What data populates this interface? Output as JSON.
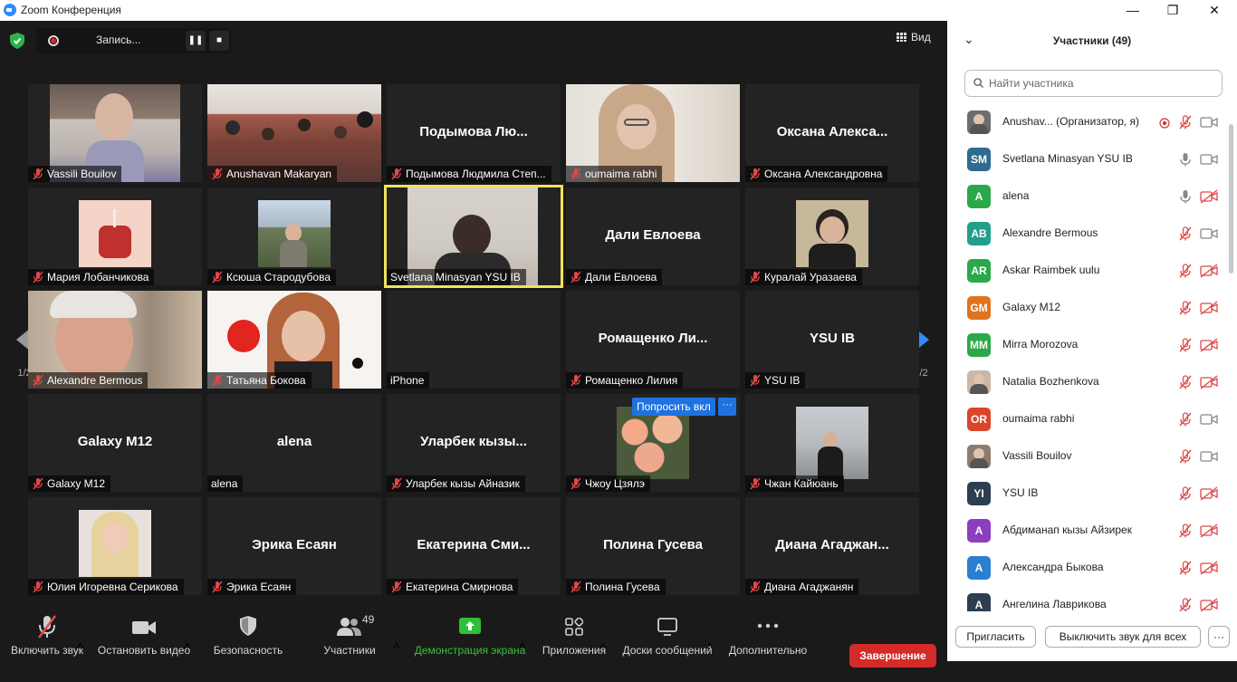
{
  "window": {
    "title": "Zoom Конференция",
    "controls": [
      "—",
      "❐",
      "✕"
    ]
  },
  "meeting": {
    "recording_label": "Запись...",
    "view_label": "Вид",
    "page_indicator_left": "1/2",
    "page_indicator_right": "1/2",
    "ask_unmute_label": "Попросить вкл",
    "more_dots": "···",
    "tiles": [
      {
        "name": "Vassili Bouilov",
        "muted": true,
        "video": true
      },
      {
        "name": "Anushavan Makaryan",
        "muted": true,
        "video": true
      },
      {
        "name": "Подымова Людмила Степ...",
        "big": "Подымова  Лю...",
        "muted": true,
        "video": false
      },
      {
        "name": "oumaima rabhi",
        "muted": true,
        "video": true
      },
      {
        "name": "Оксана Александровна",
        "big": "Оксана  Алекса...",
        "muted": true,
        "video": false
      },
      {
        "name": "Мария Лобанчикова",
        "muted": true,
        "video": true
      },
      {
        "name": "Ксюша Стародубова",
        "muted": true,
        "video": true
      },
      {
        "name": "Svetlana Minasyan YSU IB",
        "muted": false,
        "video": true,
        "active": true
      },
      {
        "name": "Дали Евлоева",
        "big": "Дали Евлоева",
        "muted": true,
        "video": false
      },
      {
        "name": "Куралай Уразаева",
        "muted": true,
        "video": true
      },
      {
        "name": "Alexandre Bermous",
        "muted": true,
        "video": true
      },
      {
        "name": "Татьяна Бокова",
        "muted": true,
        "video": true
      },
      {
        "name": "iPhone",
        "muted": false,
        "video": false
      },
      {
        "name": "Ромащенко Лилия",
        "big": "Ромащенко  Ли...",
        "muted": true,
        "video": false
      },
      {
        "name": "YSU IB",
        "big": "YSU IB",
        "muted": true,
        "video": false
      },
      {
        "name": "Galaxy M12",
        "big": "Galaxy M12",
        "muted": true,
        "video": false
      },
      {
        "name": "alena",
        "big": "alena",
        "muted": false,
        "video": false
      },
      {
        "name": "Уларбек кызы Айназик",
        "big": "Уларбек  кызы...",
        "muted": true,
        "video": false
      },
      {
        "name": "Чжоу Цзялэ",
        "muted": true,
        "video": true
      },
      {
        "name": "Чжан Кайюань",
        "muted": true,
        "video": true
      },
      {
        "name": "Юлия Игоревна Серикова",
        "muted": true,
        "video": true
      },
      {
        "name": "Эрика Есаян",
        "big": "Эрика Есаян",
        "muted": true,
        "video": false
      },
      {
        "name": "Екатерина Смирнова",
        "big": "Екатерина  Сми...",
        "muted": true,
        "video": false
      },
      {
        "name": "Полина Гусева",
        "big": "Полина Гусева",
        "muted": true,
        "video": false
      },
      {
        "name": "Диана Агаджанян",
        "big": "Диана  Агаджан...",
        "muted": true,
        "video": false
      }
    ]
  },
  "toolbar": {
    "unmute": "Включить звук",
    "video": "Остановить видео",
    "security": "Безопасность",
    "participants": "Участники",
    "participants_count": "49",
    "share": "Демонстрация экрана",
    "apps": "Приложения",
    "whiteboards": "Доски сообщений",
    "more": "Дополнительно",
    "end": "Завершение"
  },
  "panel": {
    "title": "Участники (49)",
    "search_placeholder": "Найти участника",
    "invite": "Пригласить",
    "mute_all": "Выключить звук для всех",
    "more": "···",
    "participants": [
      {
        "name": "Anushav...  (Организатор, я)",
        "initials": "",
        "color": "#6d6d6d",
        "photo": true,
        "mic": "muted",
        "cam": "on",
        "recording": true
      },
      {
        "name": "Svetlana Minasyan YSU IB",
        "initials": "SM",
        "color": "#2e6b8f",
        "mic": "on",
        "cam": "on"
      },
      {
        "name": "alena",
        "initials": "A",
        "color": "#2aa84a",
        "mic": "on",
        "cam": "off"
      },
      {
        "name": "Alexandre Bermous",
        "initials": "AB",
        "color": "#20a08a",
        "mic": "muted",
        "cam": "on"
      },
      {
        "name": "Askar Raimbek uulu",
        "initials": "AR",
        "color": "#2aa84a",
        "mic": "muted",
        "cam": "off"
      },
      {
        "name": "Galaxy M12",
        "initials": "GM",
        "color": "#e0731e",
        "mic": "muted",
        "cam": "off"
      },
      {
        "name": "Mirra Morozova",
        "initials": "MM",
        "color": "#2aa84a",
        "mic": "muted",
        "cam": "off"
      },
      {
        "name": "Natalia Bozhenkova",
        "initials": "",
        "color": "#c9b8a8",
        "photo": true,
        "mic": "muted",
        "cam": "off"
      },
      {
        "name": "oumaima rabhi",
        "initials": "OR",
        "color": "#d9452a",
        "mic": "muted",
        "cam": "on"
      },
      {
        "name": "Vassili Bouilov",
        "initials": "",
        "color": "#8c7d70",
        "photo": true,
        "mic": "muted",
        "cam": "on"
      },
      {
        "name": "YSU IB",
        "initials": "YI",
        "color": "#2c3e50",
        "mic": "muted",
        "cam": "off"
      },
      {
        "name": "Абдиманап кызы Айзирек",
        "initials": "A",
        "color": "#8a3fbf",
        "mic": "muted",
        "cam": "off"
      },
      {
        "name": "Александра Быкова",
        "initials": "A",
        "color": "#2b7fd0",
        "mic": "muted",
        "cam": "off"
      },
      {
        "name": "Ангелина Лаврикова",
        "initials": "A",
        "color": "#2c3e50",
        "mic": "muted",
        "cam": "off"
      }
    ]
  }
}
